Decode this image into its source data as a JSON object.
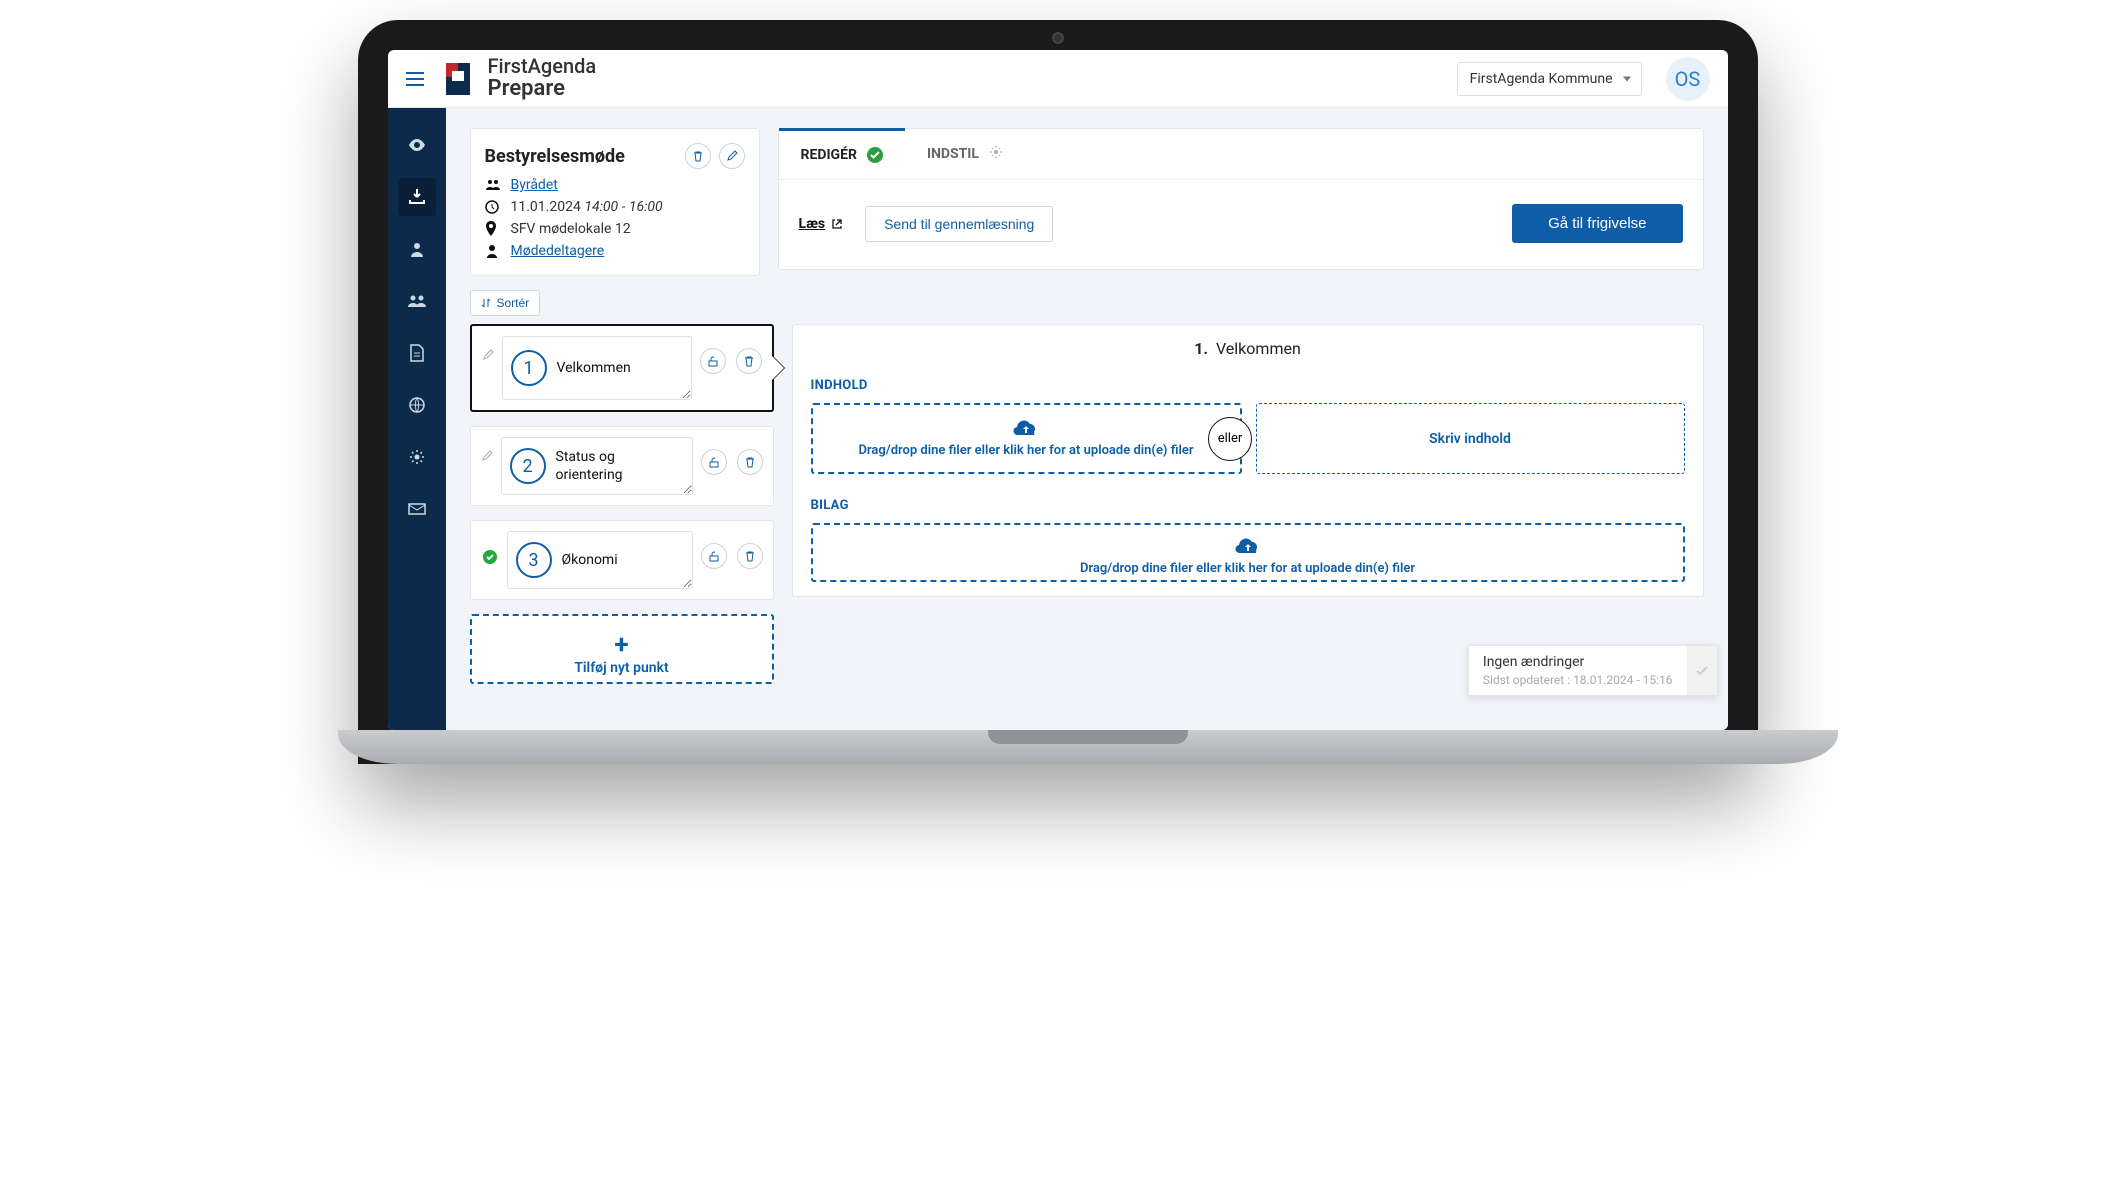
{
  "header": {
    "brand_top": "FirstAgenda",
    "brand_bottom": "Prepare",
    "org": "FirstAgenda Kommune",
    "avatar": "OS"
  },
  "meeting": {
    "title": "Bestyrelsesmøde",
    "group_link": "Byrådet",
    "date": "11.01.2024",
    "time": "14:00 - 16:00",
    "location": "SFV mødelokale 12",
    "participants_link": "Mødedeltagere"
  },
  "tabs": {
    "edit": "REDIGÉR",
    "settings": "INDSTIL",
    "read_link": "Læs",
    "send_review": "Send til gennemlæsning",
    "release": "Gå til frigivelse"
  },
  "sort_label": "Sortér",
  "agenda": {
    "items": [
      {
        "num": "1",
        "title": "Velkommen"
      },
      {
        "num": "2",
        "title": "Status og orientering"
      },
      {
        "num": "3",
        "title": "Økonomi"
      }
    ],
    "add_label": "Tilføj nyt punkt"
  },
  "detail": {
    "heading_num": "1.",
    "heading_text": "Velkommen",
    "content_label": "INDHOLD",
    "dropzone_text": "Drag/drop dine filer eller klik her for at uploade din(e) filer",
    "or_label": "eller",
    "write_content": "Skriv indhold",
    "attachments_label": "BILAG",
    "attachments_drop": "Drag/drop dine filer eller klik her for at uploade din(e) filer"
  },
  "toast": {
    "title": "Ingen ændringer",
    "subtitle": "Sidst opdateret : 18.01.2024 - 15:16"
  }
}
